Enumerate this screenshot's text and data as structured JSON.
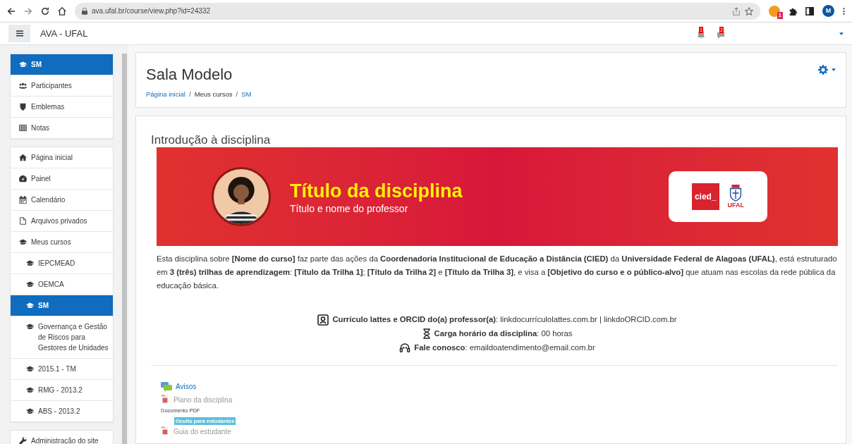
{
  "browser": {
    "url": "ava.ufal.br/course/view.php?id=24332",
    "extension_badge": "1",
    "profile_initial": "M"
  },
  "navbar": {
    "site_name": "AVA - UFAL",
    "notifications_count": "1",
    "messages_count": "2"
  },
  "sidebar": {
    "groups": [
      {
        "items": [
          {
            "label": "SM",
            "selected": true
          },
          {
            "label": "Participantes",
            "selected": false
          },
          {
            "label": "Emblemas",
            "selected": false
          },
          {
            "label": "Notas",
            "selected": false
          }
        ]
      },
      {
        "items": [
          {
            "label": "Página inicial",
            "selected": false
          },
          {
            "label": "Painel",
            "selected": false
          },
          {
            "label": "Calendário",
            "selected": false
          },
          {
            "label": "Arquivos privados",
            "selected": false
          },
          {
            "label": "Meus cursos",
            "selected": false,
            "children": [
              {
                "label": "IEPCMEAD",
                "selected": false
              },
              {
                "label": "OEMCA",
                "selected": false
              },
              {
                "label": "SM",
                "selected": true
              },
              {
                "label": "Governança e Gestão de Riscos para Gestores de Unidades",
                "selected": false
              },
              {
                "label": "2015.1 - TM",
                "selected": false
              },
              {
                "label": "RMG - 2013.2",
                "selected": false
              },
              {
                "label": "ABS - 2013.2",
                "selected": false
              }
            ]
          }
        ]
      },
      {
        "items": [
          {
            "label": "Administração do site",
            "selected": false
          }
        ]
      }
    ]
  },
  "header": {
    "title": "Sala Modelo",
    "breadcrumb": [
      {
        "label": "Página inicial",
        "kind": "link"
      },
      {
        "label": "/",
        "kind": "separator"
      },
      {
        "label": "Meus cursos",
        "kind": "text"
      },
      {
        "label": "/",
        "kind": "separator"
      },
      {
        "label": "SM",
        "kind": "link"
      }
    ]
  },
  "section": {
    "title": "Introdução à disciplina",
    "banner": {
      "title": "Título da disciplina",
      "subtitle": "Título e nome do professor",
      "logo_left": "cied_",
      "logo_right": "UFAL"
    },
    "description": "Esta disciplina sobre **[Nome do curso]** faz parte das ações da **Coordenadoria Institucional de Educação a Distância (CIED)** da **Universidade Federal de Alagoas (UFAL)**, está estruturado em **3 (três) trilhas de aprendizagem**: **[Título da Trilha 1]**; **[Título da Trilha 2]** e **[Título da Trilha 3]**, e visa a **[Objetivo do curso e o público-alvo]** que atuam nas escolas da rede pública da educação básica.",
    "info": [
      {
        "kind": "profile",
        "text": "**Currículo lattes e ORCID do(a) professor(a)**: linkdocurrículolattes.com.br | linkdoORCID.com.br"
      },
      {
        "kind": "hourglass",
        "text": "**Carga horário da disciplina**: 00 horas"
      },
      {
        "kind": "headset",
        "text": "**Fale conosco**: emaildoatendimento@email.com.br"
      }
    ],
    "activities": [
      {
        "kind": "forum",
        "name": "Avisos",
        "dimmed": false
      },
      {
        "kind": "pdf",
        "name": "Plano da disciplina",
        "dimmed": true,
        "note": "Documento PDF"
      },
      {
        "kind": "pdf",
        "name": "Guia do estudante",
        "dimmed": true,
        "badge": "Oculto para estudantes"
      }
    ]
  }
}
